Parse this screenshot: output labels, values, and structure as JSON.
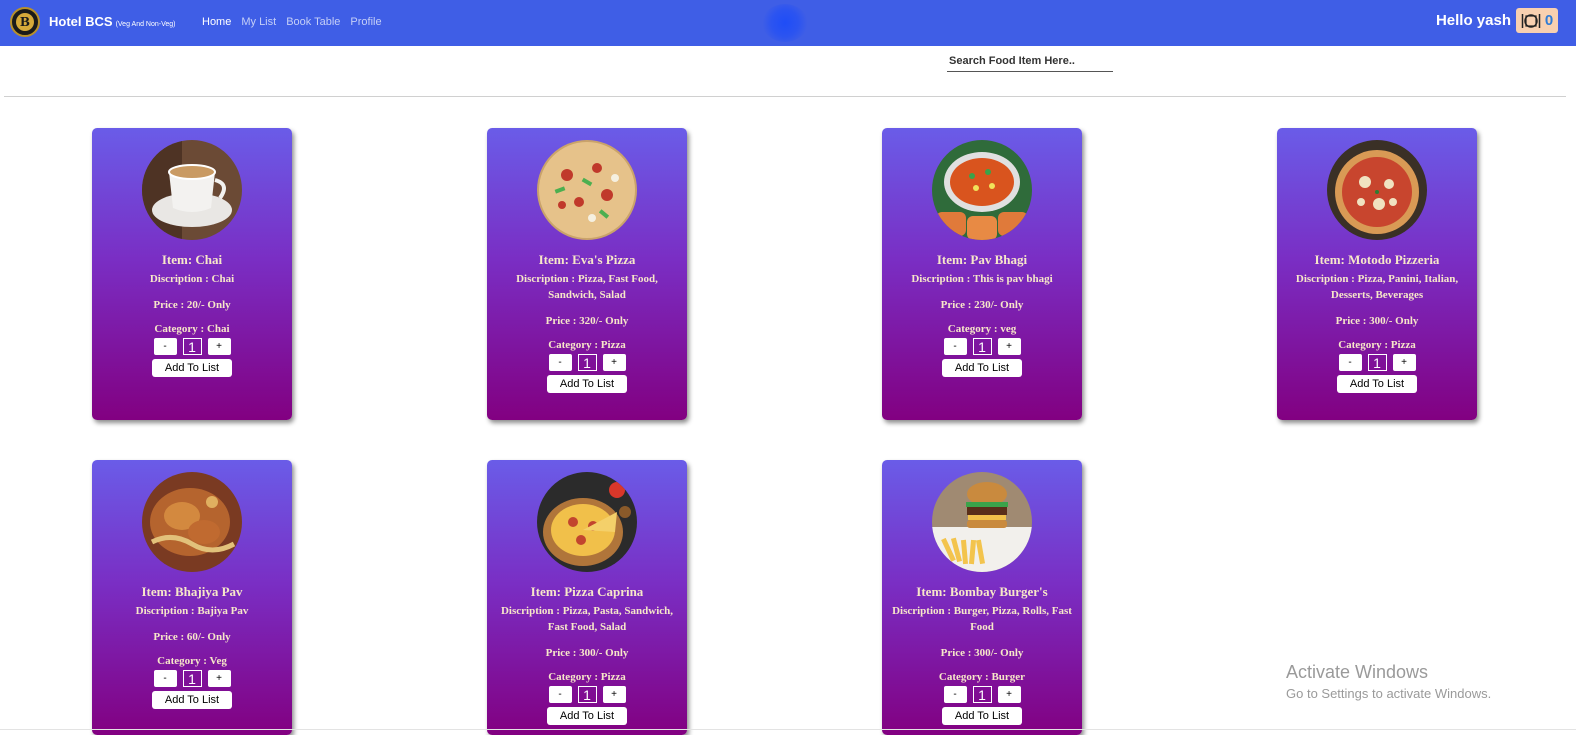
{
  "navbar": {
    "brand": "Hotel BCS",
    "brand_sub": "(Veg And Non-Veg)",
    "logo_letter": "B",
    "links": [
      "Home",
      "My List",
      "Book Table",
      "Profile"
    ],
    "greeting": "Hello yash",
    "cart_count": "0"
  },
  "search": {
    "placeholder": "Search Food Item Here.."
  },
  "cards": [
    {
      "title": "Item: Chai",
      "desc": "Discription : Chai",
      "price": "Price : 20/- Only",
      "category": "Category : Chai",
      "qty": "1",
      "button": "Add To List"
    },
    {
      "title": "Item: Eva's Pizza",
      "desc": "Discription : Pizza, Fast Food, Sandwich, Salad",
      "price": "Price : 320/- Only",
      "category": "Category : Pizza",
      "qty": "1",
      "button": "Add To List"
    },
    {
      "title": "Item: Pav Bhagi",
      "desc": "Discription : This is pav bhagi",
      "price": "Price : 230/- Only",
      "category": "Category : veg",
      "qty": "1",
      "button": "Add To List"
    },
    {
      "title": "Item: Motodo Pizzeria",
      "desc": "Discription : Pizza, Panini, Italian, Desserts, Beverages",
      "price": "Price : 300/- Only",
      "category": "Category : Pizza",
      "qty": "1",
      "button": "Add To List"
    },
    {
      "title": "Item: Bhajiya Pav",
      "desc": "Discription : Bajiya Pav",
      "price": "Price : 60/- Only",
      "category": "Category : Veg",
      "qty": "1",
      "button": "Add To List"
    },
    {
      "title": "Item: Pizza Caprina",
      "desc": "Discription : Pizza, Pasta, Sandwich, Fast Food, Salad",
      "price": "Price : 300/- Only",
      "category": "Category : Pizza",
      "qty": "1",
      "button": "Add To List"
    },
    {
      "title": "Item: Bombay Burger's",
      "desc": "Discription : Burger, Pizza, Rolls, Fast Food",
      "price": "Price : 300/- Only",
      "category": "Category : Burger",
      "qty": "1",
      "button": "Add To List"
    }
  ],
  "qty_controls": {
    "minus": "-",
    "plus": "+"
  },
  "watermark": {
    "title": "Activate Windows",
    "subtitle": "Go to Settings to activate Windows."
  },
  "colors": {
    "navbar": "#3f5ee6",
    "card_top": "#6a5ce8",
    "card_bottom": "#820081",
    "card_text": "#f7e7c9",
    "cart_badge": "#f8d0b0"
  }
}
